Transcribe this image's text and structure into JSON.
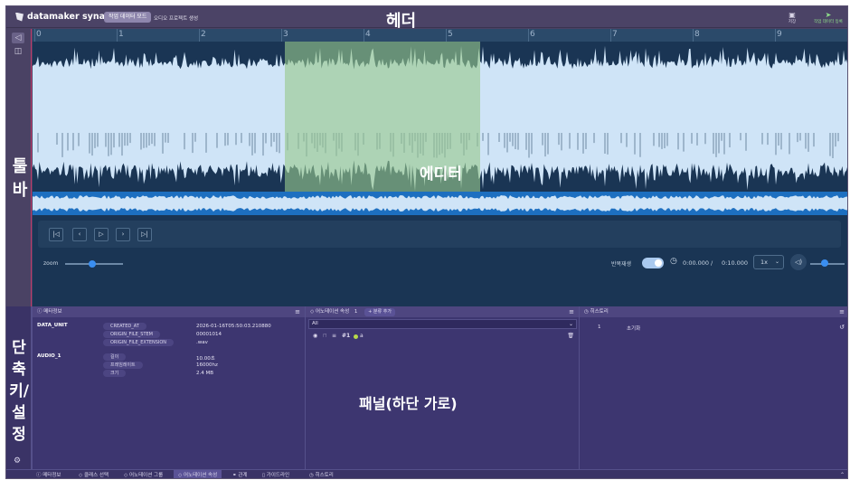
{
  "header": {
    "logo_text": "datamaker synapse",
    "mode_pill": "작업 데이터 모드",
    "link": "오디오 프로젝트 생성",
    "overlay_label": "헤더",
    "save_label": "저장",
    "submit_label": "작업 데이터 등록",
    "save_icon": "save-icon",
    "submit_icon": "send-icon"
  },
  "toolbar": {
    "overlay_label": "툴바",
    "tools": [
      {
        "icon": "pointer-icon",
        "glyph": "◁",
        "active": true
      },
      {
        "icon": "segment-icon",
        "glyph": "◫",
        "active": false
      }
    ]
  },
  "editor": {
    "overlay_label": "에디터",
    "ruler_ticks": [
      "0",
      "1",
      "2",
      "3",
      "4",
      "5",
      "6",
      "7",
      "8",
      "9"
    ],
    "duration_seconds": 10,
    "selection_seconds": [
      3.1,
      5.5
    ],
    "colors": {
      "background": "#1a3554",
      "wave_fill": "#cfe4f7",
      "wave_dark": "#1e3c5e",
      "selection": "#97c88c",
      "minimap": "#3a8ed8"
    }
  },
  "player": {
    "buttons": [
      {
        "name": "skip-start-button",
        "glyph": "|◁"
      },
      {
        "name": "prev-button",
        "glyph": "‹"
      },
      {
        "name": "play-button",
        "glyph": "▷"
      },
      {
        "name": "next-button",
        "glyph": "›"
      },
      {
        "name": "skip-end-button",
        "glyph": "▷|"
      }
    ],
    "zoom_label": "zoom",
    "zoom_level": 0.4,
    "repeat_label": "반복재생",
    "repeat_on": true,
    "time_current": "0:00.000",
    "time_separator": "/",
    "time_total": "0:10.000",
    "speed": "1x",
    "volume_level": 0.35
  },
  "panels": {
    "overlay_label": "패널(하단 가로)",
    "metadata": {
      "title": "메타정보",
      "groups": [
        {
          "label": "DATA_UNIT",
          "rows": [
            {
              "key": "CREATED_AT",
              "value": "2026-01-16T05:50:03.210880"
            },
            {
              "key": "ORIGIN_FILE_STEM",
              "value": "00001014"
            },
            {
              "key": "ORIGIN_FILE_EXTENSION",
              "value": ".wav"
            }
          ]
        },
        {
          "label": "AUDIO_1",
          "rows": [
            {
              "key": "길이",
              "value": "10.00초"
            },
            {
              "key": "프레임레이트",
              "value": "16000hz"
            },
            {
              "key": "크기",
              "value": "2.4 MB"
            }
          ]
        }
      ]
    },
    "annotations": {
      "title": "어노테이션 속성",
      "count": "1",
      "add_label": "+ 분류 추가",
      "filter_value": "All",
      "row_id": "#1",
      "row_class": "a"
    },
    "history": {
      "title": "히스토리",
      "rows": [
        {
          "num": "1",
          "text": "초기화"
        }
      ]
    }
  },
  "shortcuts": {
    "overlay_label": "단축키/설정"
  },
  "tabbar": {
    "tabs": [
      {
        "label": "메타정보",
        "icon": "info-icon",
        "active": false
      },
      {
        "label": "클래스 선택",
        "icon": "tag-icon",
        "active": false
      },
      {
        "label": "어노테이션 그룹",
        "icon": "tag-icon",
        "active": false
      },
      {
        "label": "어노테이션 속성",
        "icon": "tag-icon",
        "active": true
      },
      {
        "label": "관계",
        "icon": "link-icon",
        "active": false
      },
      {
        "label": "가이드라인",
        "icon": "book-icon",
        "active": false
      },
      {
        "label": "히스토리",
        "icon": "clock-icon",
        "active": false
      }
    ]
  }
}
